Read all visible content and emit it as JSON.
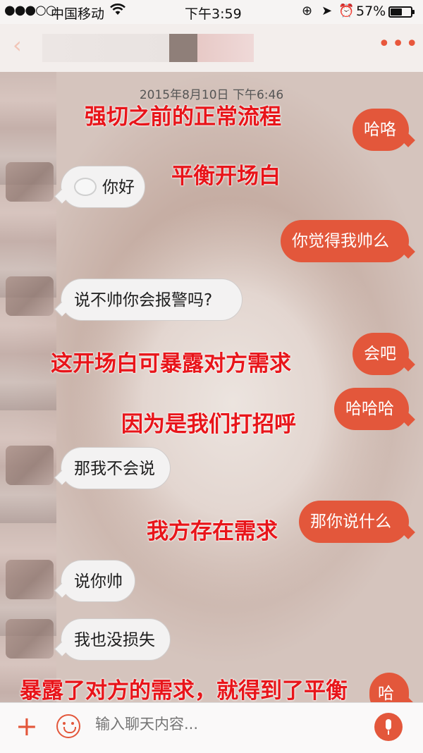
{
  "status_bar": {
    "signal_dots": "●●●○○",
    "carrier": "中国移动",
    "wifi_icon": "wifi-icon",
    "time": "下午3:59",
    "battery": "57%",
    "battery_level": 0.57
  },
  "nav": {
    "back_icon": "chevron-left-icon",
    "more_icon": "more-dots-icon",
    "more_glyph": "•••"
  },
  "chat": {
    "timestamp": "2015年8月10日 下午6:46",
    "messages": [
      {
        "from": "me",
        "text": "哈咯"
      },
      {
        "from": "them",
        "text": "你好",
        "emoji": "smiley-icon"
      },
      {
        "from": "me",
        "text": "你觉得我帅么"
      },
      {
        "from": "them",
        "text": "说不帅你会报警吗?"
      },
      {
        "from": "me",
        "text": "会吧"
      },
      {
        "from": "me",
        "text": "哈哈哈"
      },
      {
        "from": "them",
        "text": "那我不会说"
      },
      {
        "from": "me",
        "text": "那你说什么"
      },
      {
        "from": "them",
        "text": "说你帅"
      },
      {
        "from": "them",
        "text": "我也没损失"
      },
      {
        "from": "me",
        "text": "哈"
      }
    ],
    "annotations": [
      "强切之前的正常流程",
      "平衡开场白",
      "这开场白可暴露对方需求",
      "因为是我们打招呼",
      "我方存在需求",
      "暴露了对方的需求，就得到了平衡"
    ]
  },
  "input_bar": {
    "add_glyph": "+",
    "placeholder": "输入聊天内容...",
    "accent": "#e3573b"
  },
  "colors": {
    "outgoing_bubble": "#e3573b",
    "incoming_bubble": "#f3f2f2",
    "annotation": "#e8151a"
  }
}
